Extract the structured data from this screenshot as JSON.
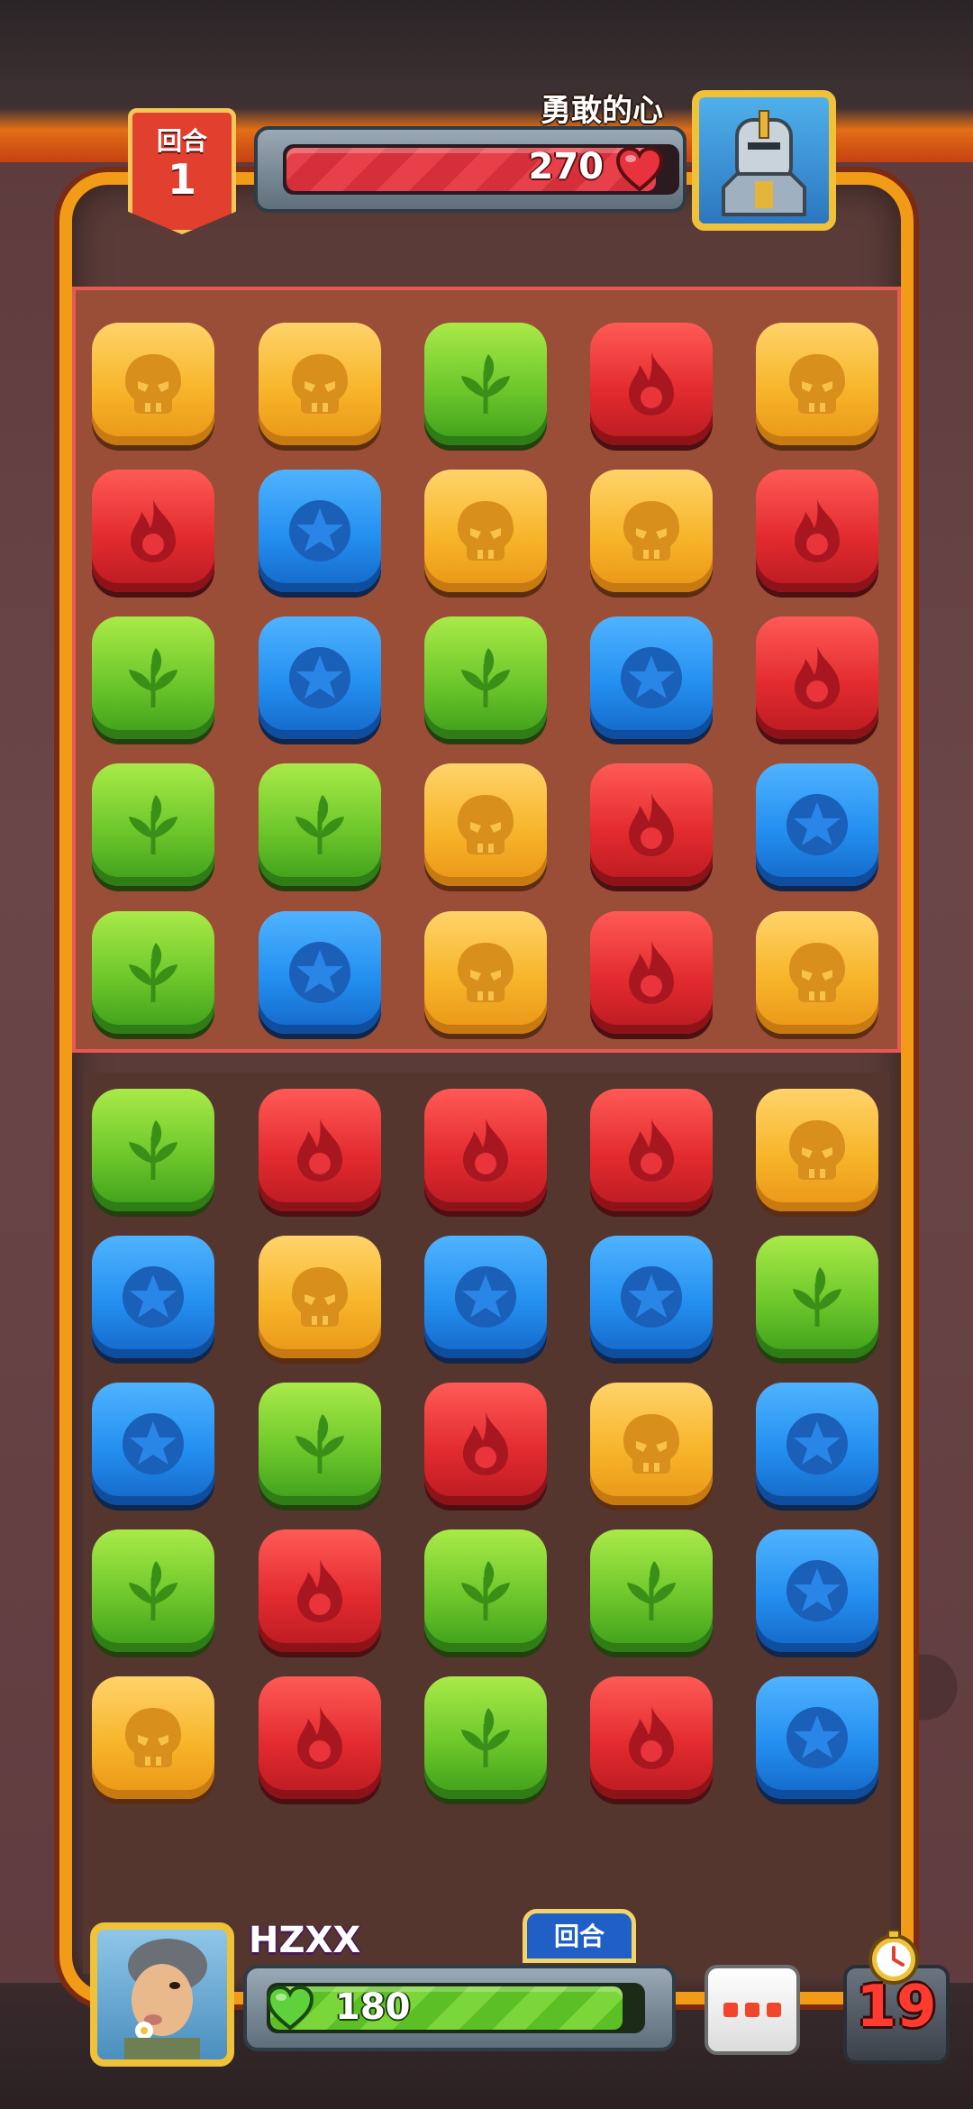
{
  "enemy": {
    "name": "勇敢的心",
    "hp_text": "270",
    "hp_fraction": 0.95,
    "portrait_icon": "armored-knight-portrait"
  },
  "round": {
    "label": "回合",
    "number": "1"
  },
  "player": {
    "name": "HZXX",
    "hp_text": "180",
    "hp_fraction": 0.95,
    "portrait_icon": "player-avatar-portrait",
    "turn_tab_label": "回合"
  },
  "timer": {
    "value": "19",
    "icon": "clock-icon"
  },
  "menu_icon": "more-options-icon",
  "colors": {
    "skull": "#f7b52a",
    "fire": "#e32b2f",
    "leaf": "#6dc72b",
    "star": "#238ff0",
    "enemy_zone": "#9a4e37",
    "enemy_zone_border": "#e55a57"
  },
  "board": {
    "columns": 5,
    "rows": [
      [
        "skull",
        "skull",
        "leaf",
        "fire",
        "skull"
      ],
      [
        "fire",
        "star",
        "skull",
        "skull",
        "fire"
      ],
      [
        "leaf",
        "star",
        "leaf",
        "star",
        "fire"
      ],
      [
        "leaf",
        "leaf",
        "skull",
        "fire",
        "star"
      ],
      [
        "leaf",
        "star",
        "skull",
        "fire",
        "skull"
      ],
      [
        "leaf",
        "fire",
        "fire",
        "fire",
        "skull"
      ],
      [
        "star",
        "skull",
        "star",
        "star",
        "leaf"
      ],
      [
        "star",
        "leaf",
        "fire",
        "skull",
        "star"
      ],
      [
        "leaf",
        "fire",
        "leaf",
        "leaf",
        "star"
      ],
      [
        "skull",
        "fire",
        "leaf",
        "fire",
        "star"
      ]
    ],
    "enemy_rows": 5
  }
}
